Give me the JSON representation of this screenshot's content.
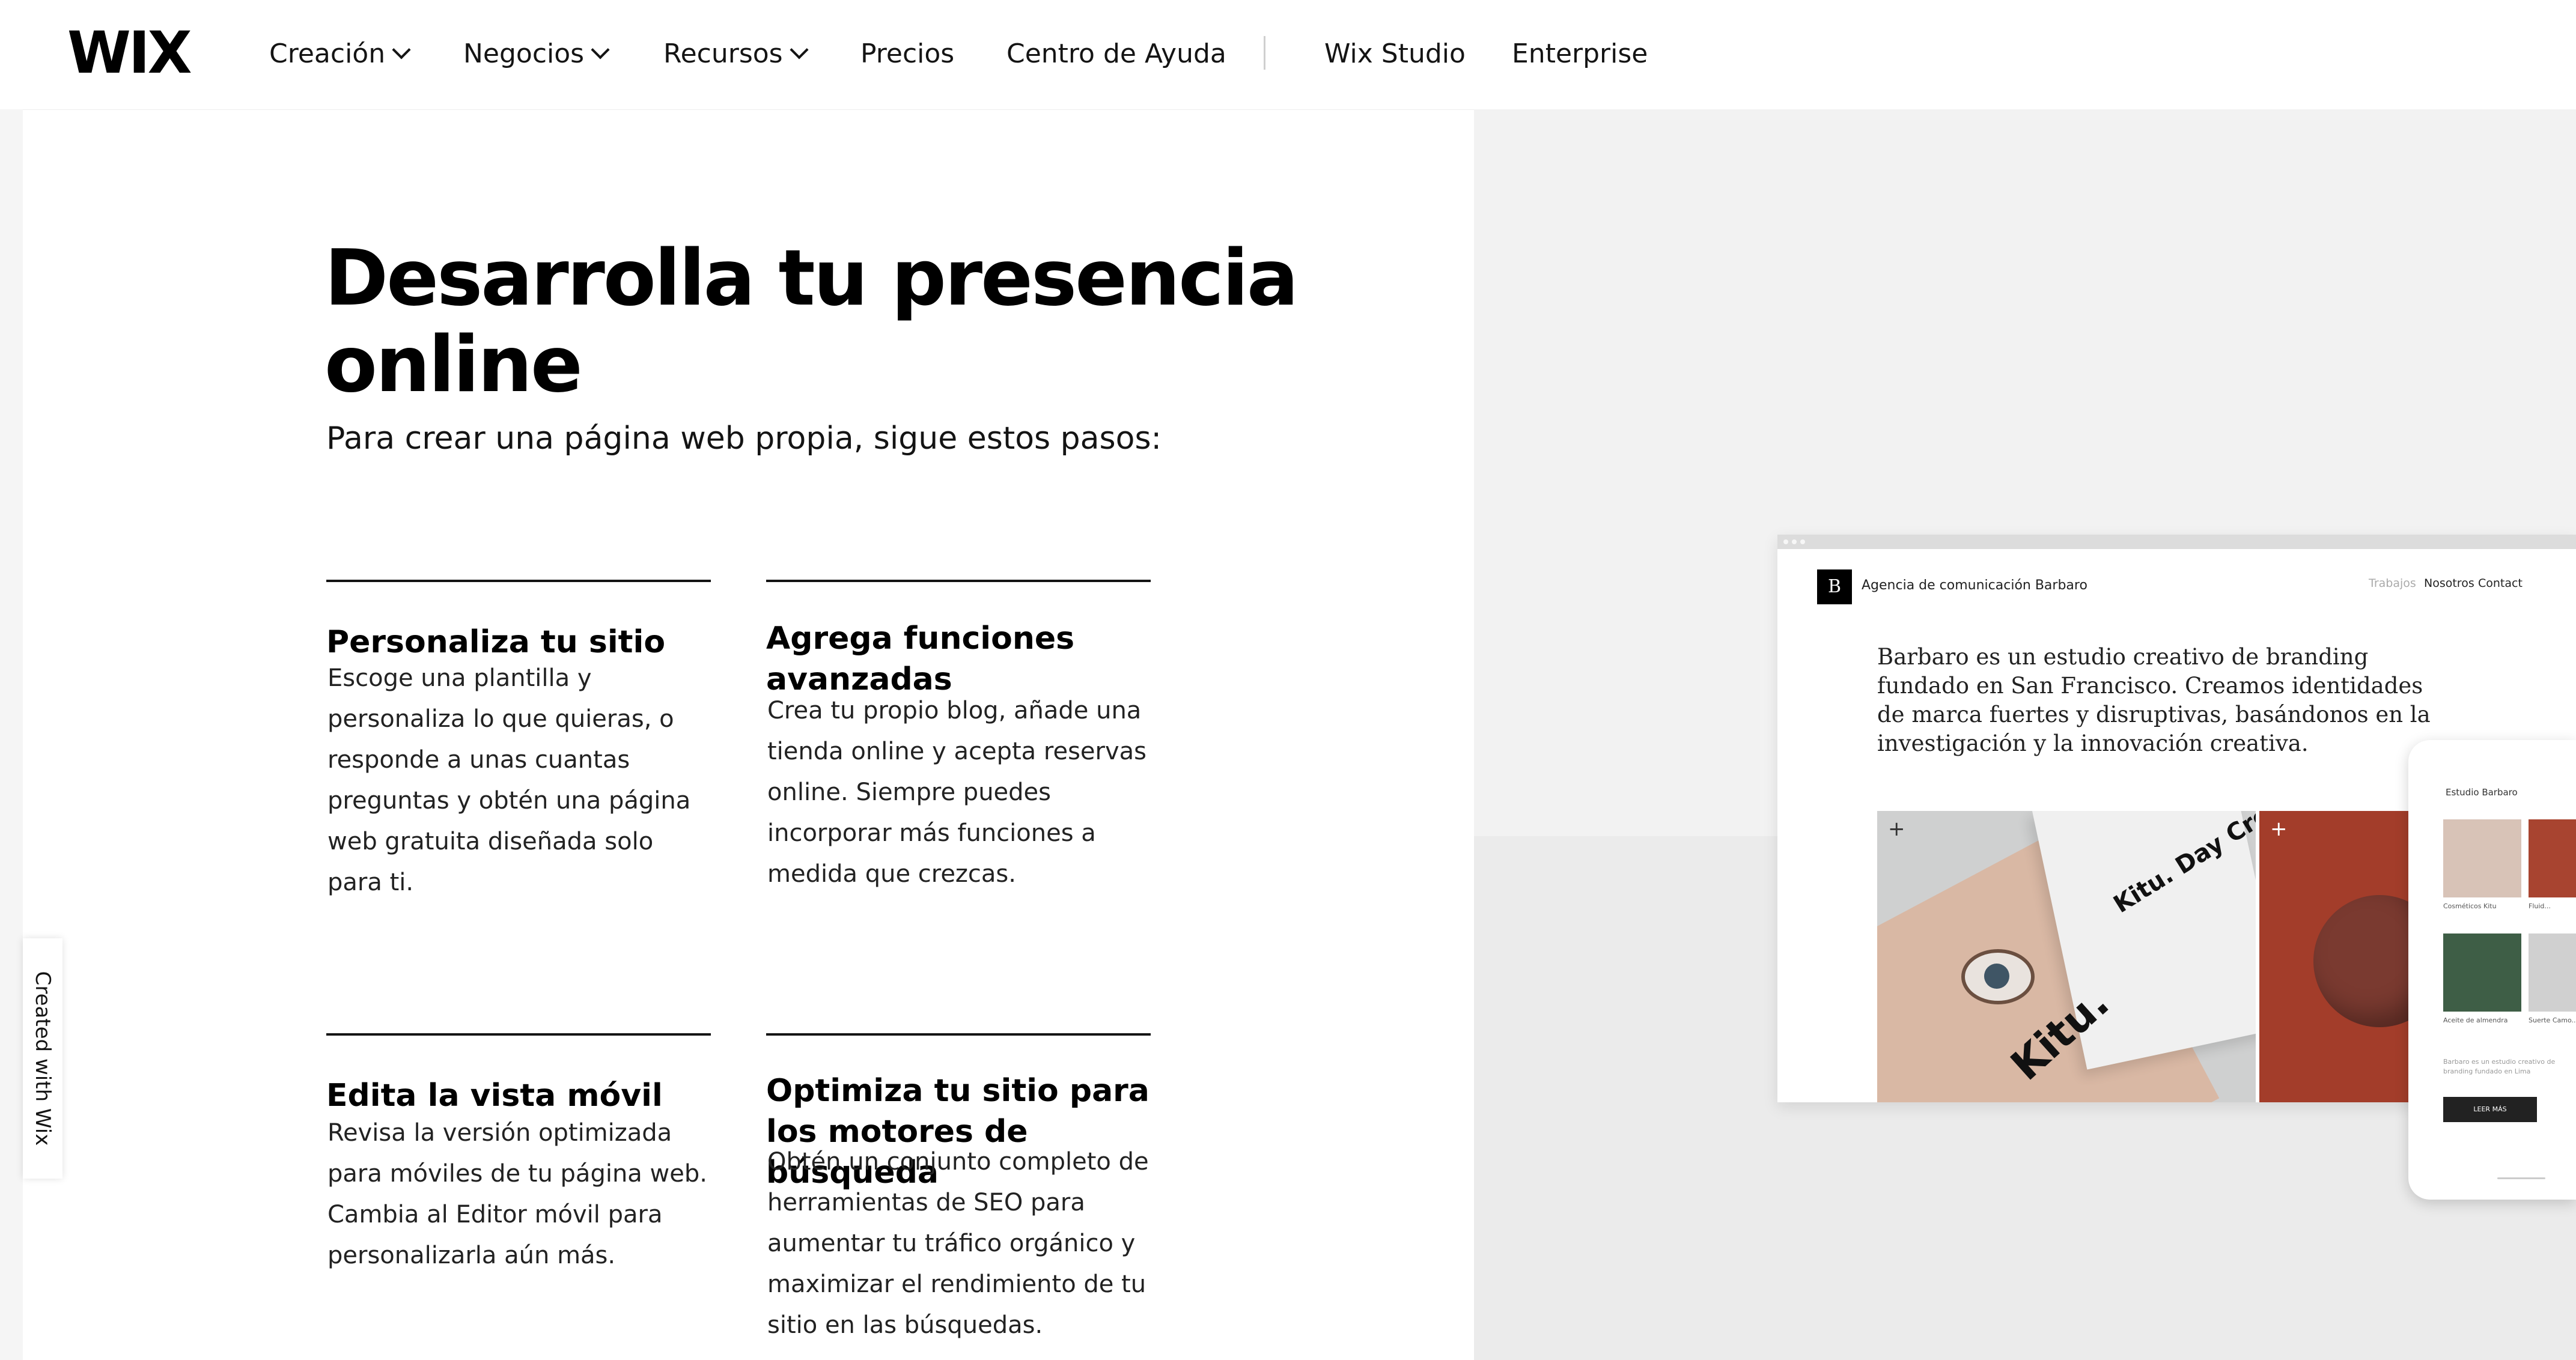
{
  "header": {
    "logo": "WIX",
    "nav": [
      {
        "label": "Creación",
        "has_dropdown": true
      },
      {
        "label": "Negocios",
        "has_dropdown": true
      },
      {
        "label": "Recursos",
        "has_dropdown": true
      },
      {
        "label": "Precios",
        "has_dropdown": false
      },
      {
        "label": "Centro de Ayuda",
        "has_dropdown": false
      },
      {
        "label": "Wix Studio",
        "has_dropdown": false
      },
      {
        "label": "Enterprise",
        "has_dropdown": false
      }
    ]
  },
  "hero": {
    "title": "Desarrolla tu presencia online",
    "subtitle": "Para crear una página web propia, sigue estos pasos:"
  },
  "steps": [
    {
      "title": "Personaliza tu sitio",
      "text": "Escoge una plantilla y personaliza lo que quieras, o responde a unas cuantas preguntas y obtén una página web gratuita diseñada solo para ti."
    },
    {
      "title": "Agrega funciones avanzadas",
      "text": "Crea tu propio blog, añade una tienda online y acepta reservas online. Siempre puedes incorporar más funciones a medida que crezcas."
    },
    {
      "title": "Edita la vista móvil",
      "text": "Revisa la versión optimizada para móviles de tu página web. Cambia al Editor móvil para personalizarla aún más."
    },
    {
      "title": "Optimiza tu sitio para los motores de búsqueda",
      "text": "Obtén un conjunto completo de herramientas de SEO para aumentar tu tráfico orgánico y maximizar el rendimiento de tu sitio en las búsquedas."
    }
  ],
  "badge": {
    "label": "Created with Wix"
  },
  "mockup": {
    "logo_letter": "B",
    "site_name": "Agencia de comunicación Barbaro",
    "nav": [
      "Trabajos",
      "Nosotros",
      "Contact"
    ],
    "intro": "Barbaro es un estudio creativo de branding fundado en San Francisco. Creamos identidades de marca fuertes y disruptivas, basándonos en la investigación y la innovación creativa.",
    "product_brand": "Kitu.",
    "product_name": "Kitu. Day Cream",
    "phone": {
      "title": "Estudio Barbaro",
      "captions": [
        "Cosméticos Kitu",
        "Fluid...",
        "Aceite de almendra",
        "Suerte Camo..."
      ],
      "text": "Barbaro es un estudio creativo de branding fundado en Lima",
      "button": "LEER MÁS"
    }
  },
  "colors": {
    "text": "#141414",
    "panel_light": "#f2f2f2",
    "panel_dark": "#ebebeb",
    "accent_red": "#a33d2a"
  }
}
